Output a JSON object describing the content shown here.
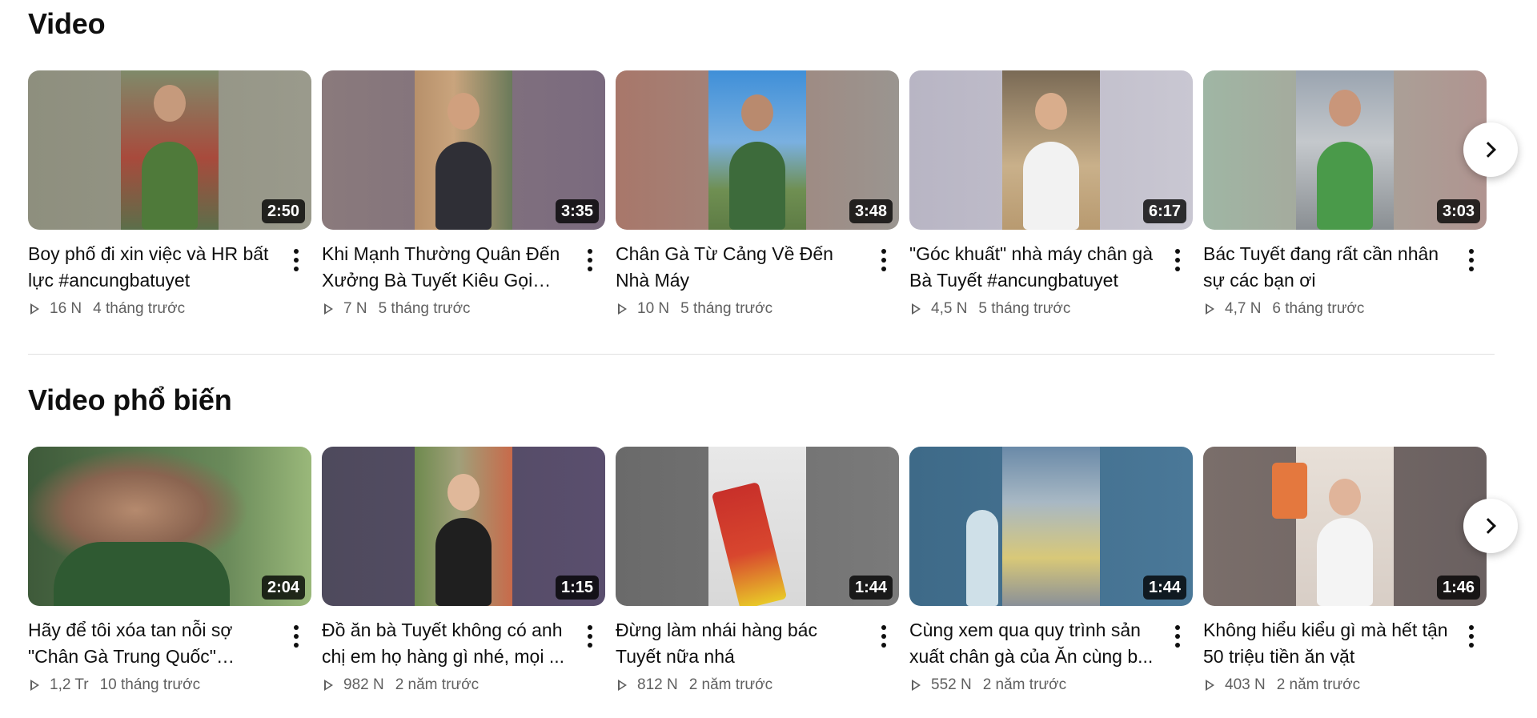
{
  "sections": [
    {
      "title": "Video",
      "videos": [
        {
          "title": "Boy phố đi xin việc và HR bất lực #ancungbatuyet",
          "duration": "2:50",
          "views": "16 N",
          "age": "4 tháng trước"
        },
        {
          "title": "Khi Mạnh Thường Quân Đến Xưởng Bà Tuyết Kiêu Gọi Từ...",
          "duration": "3:35",
          "views": "7 N",
          "age": "5 tháng trước"
        },
        {
          "title": "Chân Gà Từ Cảng Về Đến Nhà Máy",
          "duration": "3:48",
          "views": "10 N",
          "age": "5 tháng trước"
        },
        {
          "title": "\"Góc khuất\" nhà máy chân gà Bà Tuyết #ancungbatuyet",
          "duration": "6:17",
          "views": "4,5 N",
          "age": "5 tháng trước"
        },
        {
          "title": "Bác Tuyết đang rất cần nhân sự các bạn ơi",
          "duration": "3:03",
          "views": "4,7 N",
          "age": "6 tháng trước"
        }
      ]
    },
    {
      "title": "Video phổ biến",
      "videos": [
        {
          "title": "Hãy để tôi xóa tan nỗi sợ \"Chân Gà Trung Quốc\" trong...",
          "duration": "2:04",
          "views": "1,2 Tr",
          "age": "10 tháng trước"
        },
        {
          "title": "Đồ ăn bà Tuyết không có anh chị em họ hàng gì nhé, mọi ...",
          "duration": "1:15",
          "views": "982 N",
          "age": "2 năm trước"
        },
        {
          "title": "Đừng làm nhái hàng bác Tuyết nữa nhá",
          "duration": "1:44",
          "views": "812 N",
          "age": "2 năm trước"
        },
        {
          "title": "Cùng xem qua quy trình sản xuất chân gà của Ăn cùng b...",
          "duration": "1:44",
          "views": "552 N",
          "age": "2 năm trước"
        },
        {
          "title": "Không hiểu kiểu gì mà hết tận 50 triệu tiền ăn vặt",
          "duration": "1:46",
          "views": "403 N",
          "age": "2 năm trước"
        }
      ]
    }
  ],
  "icons": {
    "play": "play-outline-icon",
    "more": "more-vert-icon",
    "next": "chevron-right-icon"
  }
}
